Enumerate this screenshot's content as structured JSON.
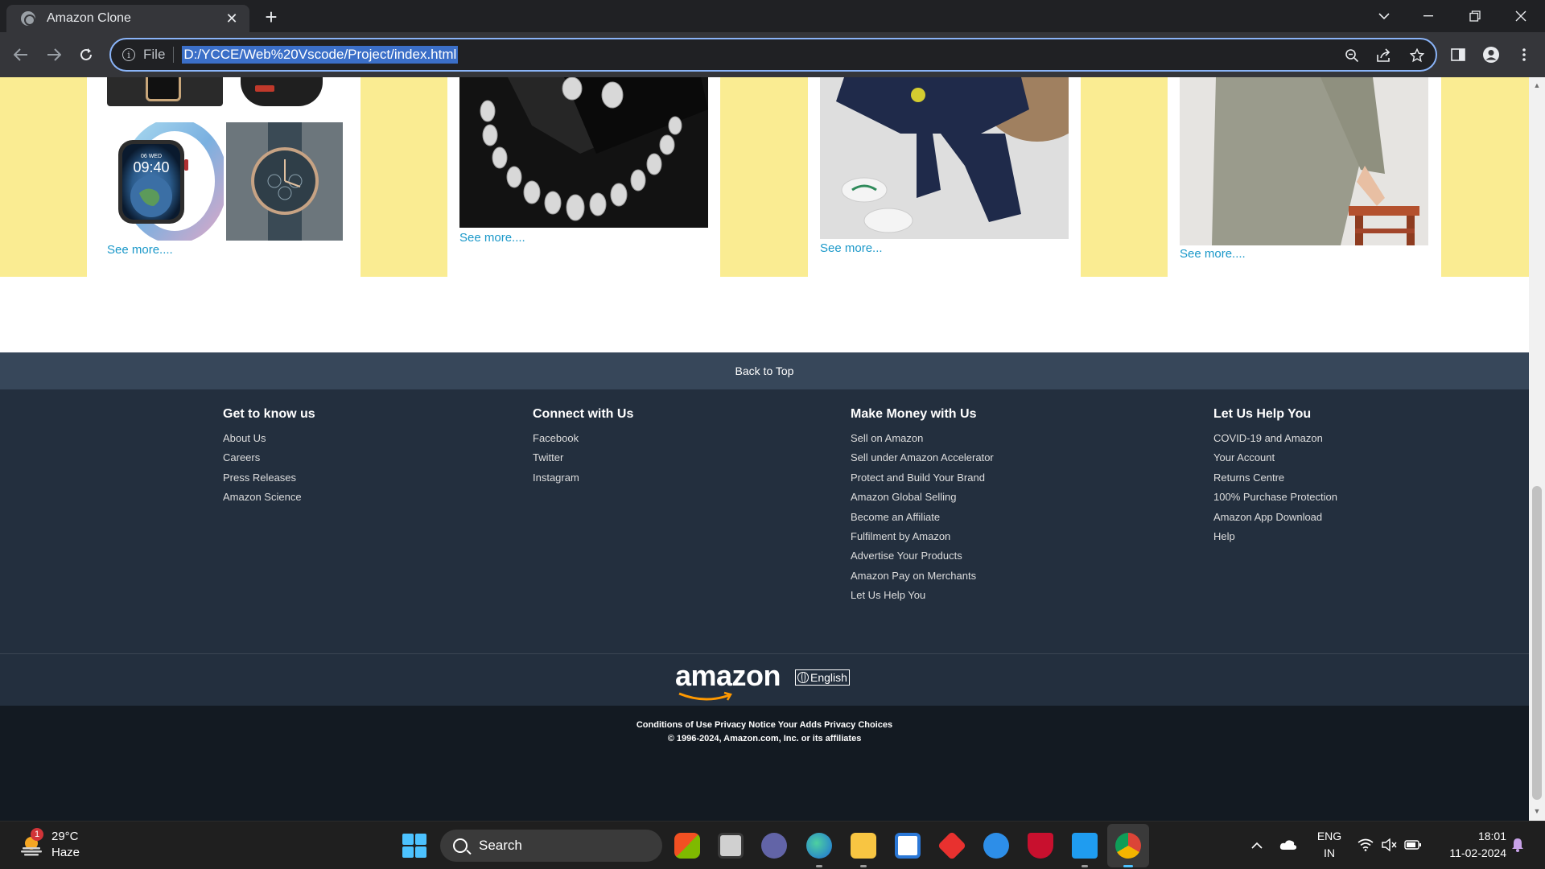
{
  "browser": {
    "tab_title": "Amazon Clone",
    "tab_close": "✕",
    "new_tab": "+",
    "omnibox_scheme": "File",
    "url": "D:/YCCE/Web%20Vscode/Project/index.html",
    "accent_color": "#8ab4f8"
  },
  "products": {
    "see_more_1": "See more....",
    "see_more_2": "See more....",
    "see_more_3": "See more...",
    "see_more_4": "See more....",
    "watch_time": "09:40",
    "watch_date": "06 WED"
  },
  "footer": {
    "back_to_top": "Back to Top",
    "columns": [
      {
        "title": "Get to know us",
        "links": [
          "About Us",
          "Careers",
          "Press Releases",
          "Amazon Science"
        ]
      },
      {
        "title": "Connect with Us",
        "links": [
          "Facebook",
          "Twitter",
          "Instagram"
        ]
      },
      {
        "title": "Make Money with Us",
        "links": [
          "Sell on Amazon",
          "Sell under Amazon Accelerator",
          "Protect and Build Your Brand",
          "Amazon Global Selling",
          "Become an Affiliate",
          "Fulfilment by Amazon",
          "Advertise Your Products",
          "Amazon Pay on Merchants",
          "Let Us Help You"
        ]
      },
      {
        "title": "Let Us Help You",
        "links": [
          "COVID-19 and Amazon",
          "Your Account",
          "Returns Centre",
          "100% Purchase Protection",
          "Amazon App Download",
          "Help"
        ]
      }
    ],
    "logo_text": "amazon",
    "language": "English",
    "legal_links": "Conditions of Use Privacy Notice Your Adds Privacy Choices",
    "copyright": "© 1996-2024, Amazon.com, Inc. or its affiliates",
    "brand_orange": "#ff9900"
  },
  "taskbar": {
    "weather_temp": "29°C",
    "weather_desc": "Haze",
    "weather_badge": "1",
    "search_label": "Search",
    "lang_top": "ENG",
    "lang_bottom": "IN",
    "time": "18:01",
    "date": "11-02-2024"
  }
}
